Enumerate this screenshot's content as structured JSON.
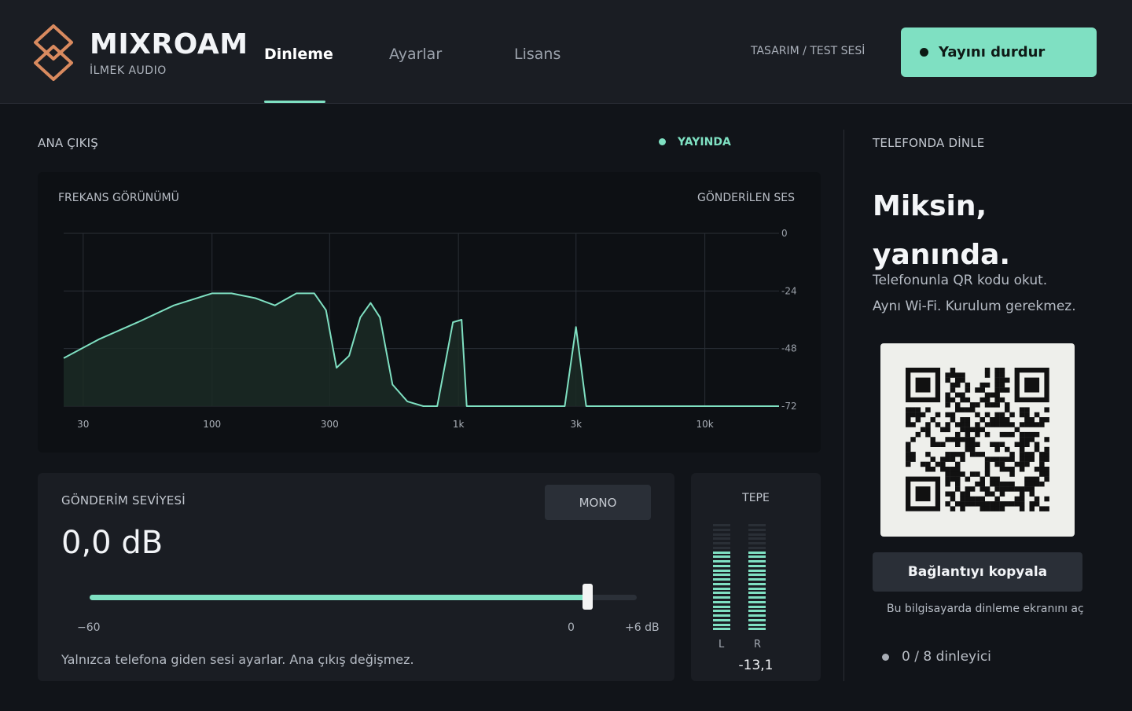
{
  "header": {
    "brand_name": "MIXROAM",
    "brand_sub": "İLMEK AUDIO",
    "tabs": [
      {
        "label": "Dinleme",
        "active": true
      },
      {
        "label": "Ayarlar",
        "active": false
      },
      {
        "label": "Lisans",
        "active": false
      }
    ],
    "design_label": "TASARIM / TEST SESİ",
    "stop_button": "Yayını durdur"
  },
  "main_output": {
    "title": "ANA ÇIKIŞ",
    "status": "YAYINDA"
  },
  "frequency": {
    "title": "FREKANS GÖRÜNÜMÜ",
    "right_label": "GÖNDERİLEN SES"
  },
  "chart_data": {
    "type": "area",
    "xlabel": "",
    "ylabel": "",
    "x_scale": "log",
    "x_ticks": [
      "30",
      "100",
      "300",
      "1k",
      "3k",
      "10k"
    ],
    "y_ticks": [
      "0",
      "-24",
      "-48",
      "-72"
    ],
    "ylim": [
      -72,
      0
    ],
    "xlim": [
      25,
      20000
    ],
    "grid": true,
    "x": [
      25,
      35,
      50,
      70,
      100,
      120,
      150,
      180,
      220,
      260,
      290,
      320,
      360,
      400,
      440,
      480,
      540,
      620,
      720,
      820,
      950,
      1030,
      1080,
      2700,
      3000,
      3300,
      20000
    ],
    "y": [
      -52,
      -44,
      -37,
      -30,
      -25,
      -25,
      -27,
      -30,
      -25,
      -25,
      -32,
      -56,
      -51,
      -35,
      -29,
      -35,
      -63,
      -70,
      -72,
      -72,
      -37,
      -36,
      -72,
      -72,
      -39,
      -72,
      -72
    ]
  },
  "send": {
    "title": "GÖNDERİM SEVİYESİ",
    "value": "0,0 dB",
    "mono_label": "MONO",
    "slider_min_label": "−60",
    "slider_zero_label": "0",
    "slider_max_label": "+6 dB",
    "slider_value_db": 0,
    "slider_min_db": -60,
    "slider_max_db": 6,
    "help": "Yalnızca telefona giden sesi ayarlar. Ana çıkış değişmez."
  },
  "peak": {
    "title": "TEPE",
    "left_label": "L",
    "right_label": "R",
    "value": "-13,1",
    "left_level": 0.77,
    "right_level": 0.73
  },
  "phone": {
    "title": "TELEFONDA DİNLE",
    "hero_line1": "Miksin,",
    "hero_line2": "yanında.",
    "desc_line1": "Telefonunla QR kodu okut.",
    "desc_line2": "Aynı Wi-Fi. Kurulum gerekmez.",
    "copy_button": "Bağlantıyı kopyala",
    "local_link": "Bu bilgisayarda dinleme ekranını aç",
    "listeners": "0 / 8 dinleyici"
  },
  "colors": {
    "accent": "#7fe0c2",
    "logo": "#d98a5f",
    "background": "#111419",
    "panel": "#1a1d23"
  }
}
